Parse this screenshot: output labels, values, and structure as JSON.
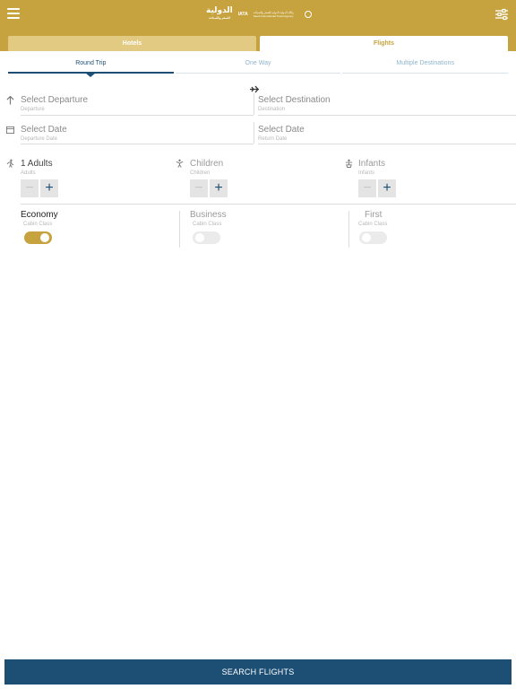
{
  "header": {
    "menu_icon": "hamburger-menu-icon",
    "filter_icon": "sliders-icon",
    "brand_text": "الدولية",
    "brand_sub": "للسفر والسياحة",
    "iata_text": "IATA",
    "agency_text": "وكالة الدولية الدولية للسفر والسياحة Saudi International Travel Agency",
    "accent_color": "#c6a33f"
  },
  "tabs": [
    {
      "label": "Hotels",
      "active": false
    },
    {
      "label": "Flights",
      "active": true
    }
  ],
  "trip_types": [
    {
      "label": "Round Trip",
      "active": true
    },
    {
      "label": "One Way",
      "active": false
    },
    {
      "label": "Multiple Destinations",
      "active": false
    }
  ],
  "route": {
    "departure": {
      "placeholder": "Select Departure",
      "sublabel": "Departure",
      "icon": "plane-departure-icon"
    },
    "destination": {
      "placeholder": "Select Destination",
      "sublabel": "Destination",
      "icon": "plane-icon"
    }
  },
  "dates": {
    "departure": {
      "placeholder": "Select Date",
      "sublabel": "Departure Date",
      "icon": "calendar-icon"
    },
    "return": {
      "placeholder": "Select Date",
      "sublabel": "Return Date"
    }
  },
  "passengers": [
    {
      "label": "1 Adults",
      "sublabel": "Adults",
      "icon": "adult-icon",
      "minus": "−",
      "plus": "+"
    },
    {
      "label": "Children",
      "sublabel": "Children",
      "icon": "child-icon",
      "minus": "−",
      "plus": "+"
    },
    {
      "label": "Infants",
      "sublabel": "Infants",
      "icon": "infant-icon",
      "minus": "−",
      "plus": "+"
    }
  ],
  "cabin_classes": [
    {
      "label": "Economy",
      "sublabel": "Cabin Class",
      "selected": true
    },
    {
      "label": "Business",
      "sublabel": "Cabin Class",
      "selected": false
    },
    {
      "label": "First",
      "sublabel": "Cabin Class",
      "selected": false
    }
  ],
  "search_button": {
    "label": "SEARCH FLIGHTS",
    "color": "#1d4f75"
  }
}
